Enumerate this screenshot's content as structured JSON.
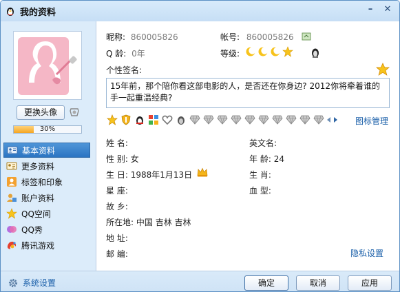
{
  "window": {
    "title": "我的资料",
    "minimize_icon": "minimize-icon",
    "close_icon": "close-icon"
  },
  "left": {
    "change_avatar_label": "更换头像",
    "progress_text": "30%",
    "progress_value": 0.3,
    "nav": [
      {
        "label": "基本资料",
        "icon": "id-card-icon",
        "active": true
      },
      {
        "label": "更多资料",
        "icon": "card-icon",
        "active": false
      },
      {
        "label": "标签和印象",
        "icon": "tag-person-icon",
        "active": false
      },
      {
        "label": "账户资料",
        "icon": "account-icon",
        "active": false
      },
      {
        "label": "QQ空间",
        "icon": "star-icon",
        "active": false
      },
      {
        "label": "QQ秀",
        "icon": "qqshow-icon",
        "active": false
      },
      {
        "label": "腾讯游戏",
        "icon": "game-icon",
        "active": false
      }
    ]
  },
  "profile": {
    "nickname_label": "昵称:",
    "nickname": "860005826",
    "account_label": "帐号:",
    "account": "860005826",
    "qage_label": "Q 龄:",
    "qage": "0年",
    "level_label": "等级:",
    "signature_label": "个性签名:",
    "signature": "15年前，那个陪你看这部电影的人，是否还在你身边? 2012你将牵着谁的手一起重温经典?",
    "icon_manage": "图标管理",
    "name_label": "姓    名:",
    "name": "",
    "english_name_label": "英文名:",
    "english_name": "",
    "gender_label": "性    别:",
    "gender": "女",
    "age_label": "年    龄:",
    "age": "24",
    "birthday_label": "生    日:",
    "birthday": "1988年1月13日",
    "zodiac_label": "生    肖:",
    "zodiac": "",
    "constellation_label": "星    座:",
    "constellation": "",
    "blood_label": "血    型:",
    "blood": "",
    "hometown_label": "故    乡:",
    "hometown": "",
    "location_label": "所在地:",
    "location": "中国  吉林  吉林",
    "address_label": "地    址:",
    "address": "",
    "postcode_label": "邮    编:",
    "postcode": "",
    "privacy_settings": "隐私设置"
  },
  "bottom": {
    "system_settings": "系统设置",
    "ok": "确定",
    "cancel": "取消",
    "apply": "应用"
  },
  "colors": {
    "active_nav": "#2c75c2",
    "link": "#1a5fa9",
    "progress": "#f5a623"
  }
}
